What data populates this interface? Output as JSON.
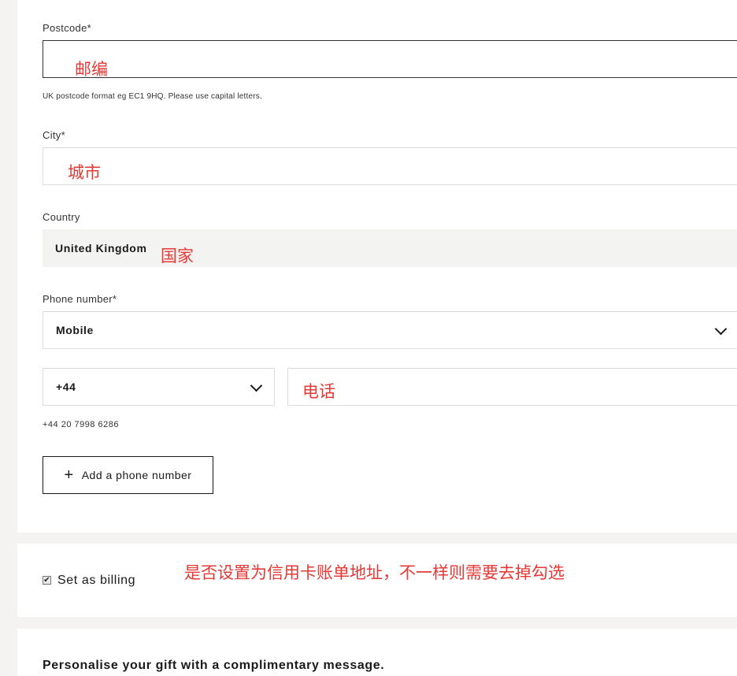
{
  "postcode": {
    "label": "Postcode*",
    "annotation": "邮编",
    "hint": "UK postcode format eg EC1 9HQ. Please use capital letters."
  },
  "city": {
    "label": "City*",
    "annotation": "城市"
  },
  "country": {
    "label": "Country",
    "value": "United Kingdom",
    "annotation": "国家"
  },
  "phone": {
    "label": "Phone number*",
    "type_value": "Mobile",
    "code_value": "+44",
    "annotation": "电话",
    "hint": "+44 20 7998 6286",
    "add_label": "Add a phone number",
    "add_icon": "plus-icon",
    "chevron_icon": "chevron-down-icon"
  },
  "billing": {
    "checked": true,
    "label": "Set as billing",
    "annotation": "是否设置为信用卡账单地址，不一样则需要去掉勾选"
  },
  "gift": {
    "title": "Personalise your gift with a complimentary message."
  },
  "colors": {
    "annotation": "#e53935",
    "background": "#f4f3f1",
    "panel": "#ffffff"
  }
}
